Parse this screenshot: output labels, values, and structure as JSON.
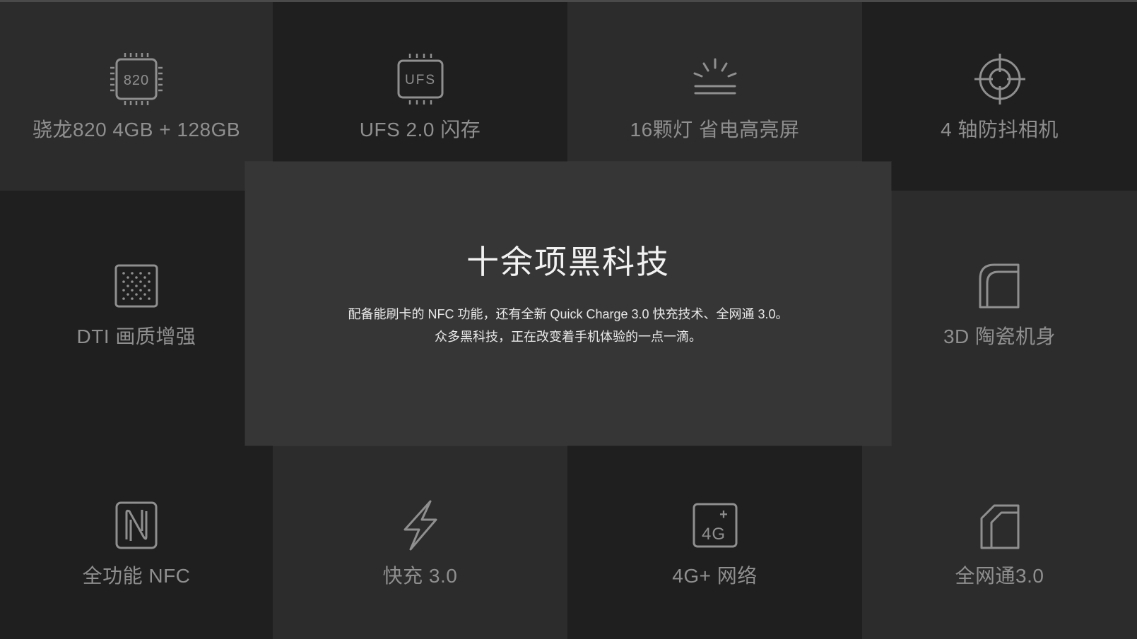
{
  "features": {
    "snapdragon": {
      "label": "骁龙820 4GB + 128GB",
      "chip_text": "820"
    },
    "ufs": {
      "label": "UFS 2.0 闪存",
      "chip_text": "UFS"
    },
    "display": {
      "label": "16颗灯 省电高亮屏"
    },
    "camera": {
      "label": "4 轴防抖相机"
    },
    "dti": {
      "label": "DTI 画质增强"
    },
    "ceramic": {
      "label": "3D 陶瓷机身"
    },
    "nfc": {
      "label": "全功能 NFC"
    },
    "quickcharge": {
      "label": "快充 3.0"
    },
    "network_4g": {
      "label": "4G+ 网络",
      "icon_text": "4G",
      "icon_plus": "+"
    },
    "full_network": {
      "label": "全网通3.0"
    }
  },
  "overlay": {
    "title": "十余项黑科技",
    "line1": "配备能刷卡的 NFC 功能，还有全新 Quick Charge 3.0 快充技术、全网通 3.0。",
    "line2": "众多黑科技，正在改变着手机体验的一点一滴。"
  },
  "colors": {
    "icon_stroke": "#8f8f8f",
    "label": "#8f8f8f",
    "overlay_bg": "#373737",
    "title": "#f2f2f2"
  }
}
